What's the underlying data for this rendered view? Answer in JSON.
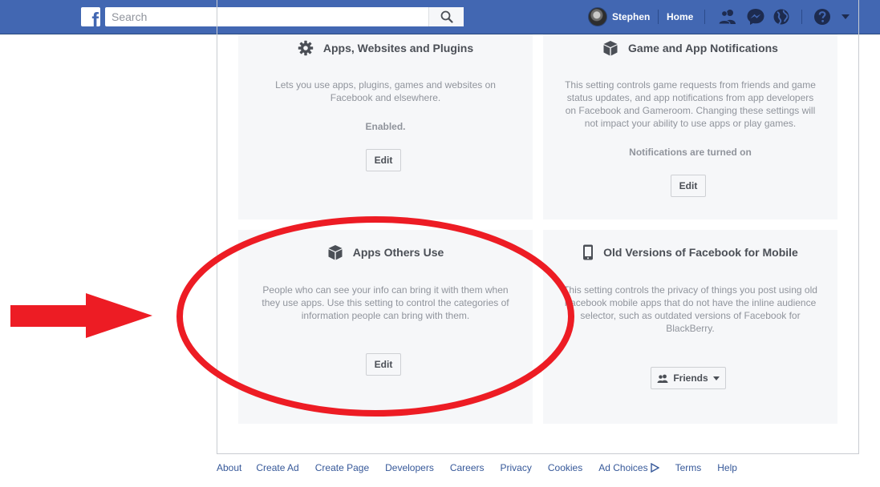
{
  "topbar": {
    "logo_letter": "f",
    "search_placeholder": "Search",
    "user_name": "Stephen",
    "home_label": "Home",
    "icons": [
      "friend-requests-icon",
      "messenger-icon",
      "notifications-globe-icon",
      "help-icon",
      "account-menu-caret-icon"
    ]
  },
  "cards": [
    {
      "title": "Apps, Websites and Plugins",
      "icon": "gear-icon",
      "description": "Lets you use apps, plugins, games and websites on Facebook and elsewhere.",
      "status": "Enabled.",
      "button_label": "Edit"
    },
    {
      "title": "Game and App Notifications",
      "icon": "cube-icon",
      "description": "This setting controls game requests from friends and game status updates, and app notifications from app developers on Facebook and Gameroom. Changing these settings will not impact your ability to use apps or play games.",
      "status": "Notifications are turned on",
      "button_label": "Edit"
    },
    {
      "title": "Apps Others Use",
      "icon": "cube-icon",
      "description": "People who can see your info can bring it with them when they use apps. Use this setting to control the categories of information people can bring with them.",
      "button_label": "Edit"
    },
    {
      "title": "Old Versions of Facebook for Mobile",
      "icon": "mobile-phone-icon",
      "description": "This setting controls the privacy of things you post using old Facebook mobile apps that do not have the inline audience selector, such as outdated versions of Facebook for BlackBerry.",
      "dropdown_value": "Friends"
    }
  ],
  "footer": {
    "links": [
      "About",
      "Create Ad",
      "Create Page",
      "Developers",
      "Careers",
      "Privacy",
      "Cookies",
      "Ad Choices",
      "Terms",
      "Help"
    ]
  },
  "annotation": {
    "color": "#ed1c24",
    "target": "Apps Others Use"
  },
  "colors": {
    "brand_blue": "#4267b2",
    "card_bg": "#f6f7f9",
    "muted_text": "#90949c",
    "link": "#365899"
  }
}
